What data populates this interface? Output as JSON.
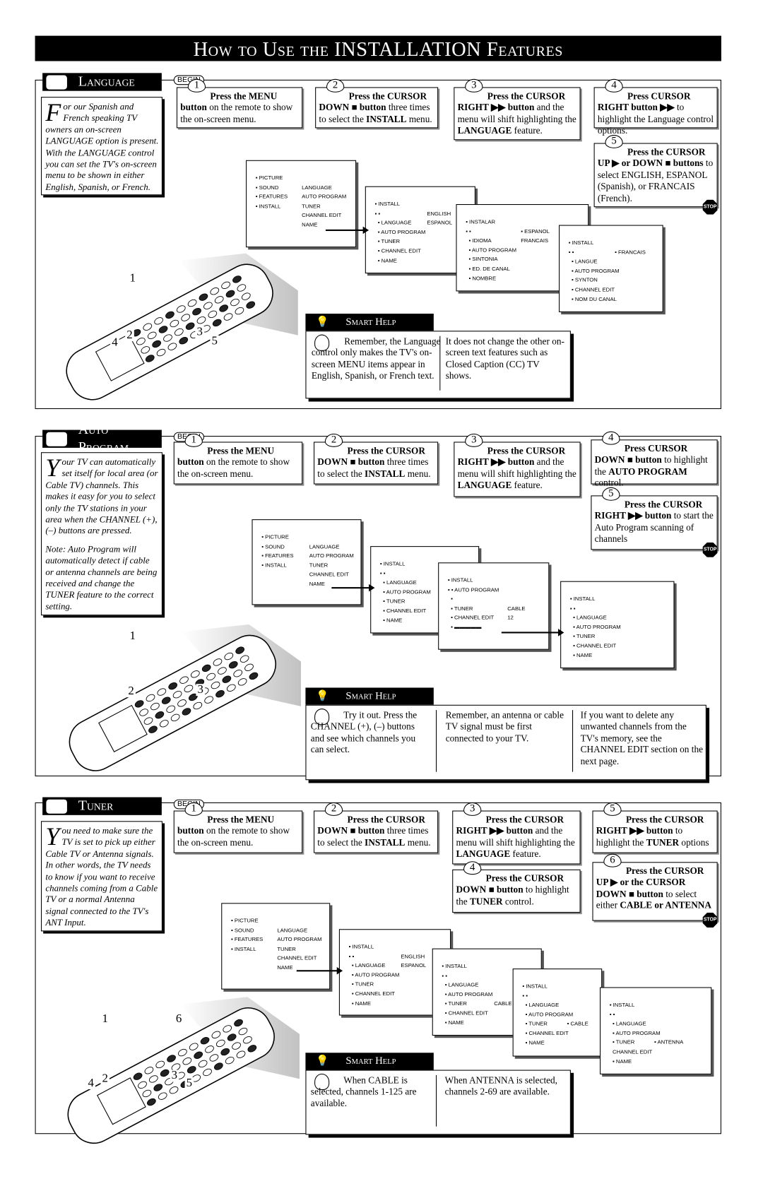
{
  "header": {
    "title": "How to Use the INSTALLATION Features"
  },
  "begin_label": "BEGIN",
  "stop_label": "STOP",
  "sections": [
    {
      "title": "Language",
      "intro": {
        "drop": "F",
        "paragraphs": [
          "or our Spanish and French speaking TV owners an on-screen LANGUAGE option is present. With the LANGUAGE control you can set the TV's on-screen menu to be shown in either English, Spanish, or French."
        ]
      },
      "steps": [
        {
          "n": "1",
          "segs": [
            {
              "t": "Press the MENU button",
              "b": true
            },
            {
              "t": " on the remote to show the on-screen menu."
            }
          ]
        },
        {
          "n": "2",
          "segs": [
            {
              "t": "Press the CURSOR DOWN ■ button",
              "b": true
            },
            {
              "t": " three times to select the "
            },
            {
              "t": "INSTALL",
              "b": true
            },
            {
              "t": " menu."
            }
          ]
        },
        {
          "n": "3",
          "segs": [
            {
              "t": "Press the CURSOR RIGHT ▶▶ button",
              "b": true
            },
            {
              "t": " and the menu will shift highlighting the "
            },
            {
              "t": "LANGUAGE",
              "b": true
            },
            {
              "t": " feature."
            }
          ]
        },
        {
          "n": "4",
          "segs": [
            {
              "t": "Press CURSOR RIGHT button ▶▶",
              "b": true
            },
            {
              "t": " to highlight the Language control options."
            }
          ]
        },
        {
          "n": "5",
          "segs": [
            {
              "t": "Press the CURSOR UP ▶ or DOWN ■ buttons",
              "b": true
            },
            {
              "t": " to select ENGLISH, ESPANOL (Spanish), or FRANCAIS (French)."
            }
          ]
        }
      ],
      "menus": [
        [
          [
            "▪ PICTURE",
            ""
          ],
          [
            "▪ SOUND",
            "LANGUAGE"
          ],
          [
            "▪ FEATURES",
            "AUTO PROGRAM"
          ],
          [
            "▪ INSTALL",
            "TUNER"
          ],
          [
            "",
            "CHANNEL EDIT"
          ],
          [
            "",
            "NAME"
          ]
        ],
        [
          [
            "▪ INSTALL",
            ""
          ],
          [
            "▪ ▪",
            "ENGLISH"
          ],
          [
            "  ▪ LANGUAGE",
            "ESPANOL"
          ],
          [
            "  ▪ AUTO PROGRAM",
            ""
          ],
          [
            "  ▪ TUNER",
            ""
          ],
          [
            "  ▪ CHANNEL EDIT",
            ""
          ],
          [
            "  ▪ NAME",
            ""
          ]
        ],
        [
          [
            "▪ INSTALAR",
            ""
          ],
          [
            "▪ ▪",
            "▪ ESPANOL"
          ],
          [
            "  ▪ IDIOMA",
            "FRANCAIS"
          ],
          [
            "  ▪ AUTO PROGRAM",
            ""
          ],
          [
            "  ▪ SINTONIA",
            ""
          ],
          [
            "  ▪ ED. DE CANAL",
            ""
          ],
          [
            "  ▪ NOMBRE",
            ""
          ]
        ],
        [
          [
            "▪ INSTALL",
            ""
          ],
          [
            "▪ ▪",
            "▪ FRANCAIS"
          ],
          [
            "  ▪ LANGUE",
            ""
          ],
          [
            "  ▪ AUTO PROGRAM",
            ""
          ],
          [
            "  ▪ SYNTON",
            ""
          ],
          [
            "  ▪ CHANNEL EDIT",
            ""
          ],
          [
            "  ▪ NOM DU CANAL",
            ""
          ]
        ]
      ],
      "smart_help": {
        "title": "Smart Help",
        "columns": [
          "Remember, the Language control only makes the TV's on-screen MENU items appear in English, Spanish, or French text.",
          "It does not change the other on-screen text features such as Closed Caption (CC) TV shows."
        ]
      },
      "callouts": [
        "1",
        "2",
        "4",
        "3",
        "5"
      ]
    },
    {
      "title": "Auto Program",
      "intro": {
        "drop": "Y",
        "paragraphs": [
          "our TV can automatically set itself for local area (or Cable TV) channels. This makes it easy for you to select only the TV stations in your area when the CHANNEL (+), (–) buttons are pressed.",
          "Note: Auto Program will automatically detect if cable or antenna channels are being received and change the TUNER feature to the correct setting."
        ]
      },
      "steps": [
        {
          "n": "1",
          "segs": [
            {
              "t": "Press the MENU button",
              "b": true
            },
            {
              "t": " on the remote to show the on-screen menu."
            }
          ]
        },
        {
          "n": "2",
          "segs": [
            {
              "t": "Press the CURSOR DOWN ■ button",
              "b": true
            },
            {
              "t": " three times to select the "
            },
            {
              "t": "INSTALL",
              "b": true
            },
            {
              "t": " menu."
            }
          ]
        },
        {
          "n": "3",
          "segs": [
            {
              "t": "Press the CURSOR RIGHT ▶▶ button",
              "b": true
            },
            {
              "t": " and the menu will shift highlighting the "
            },
            {
              "t": "LANGUAGE",
              "b": true
            },
            {
              "t": " feature."
            }
          ]
        },
        {
          "n": "4",
          "segs": [
            {
              "t": "Press CURSOR DOWN ■ button",
              "b": true
            },
            {
              "t": " to highlight the "
            },
            {
              "t": "AUTO PROGRAM",
              "b": true
            },
            {
              "t": " control."
            }
          ]
        },
        {
          "n": "5",
          "segs": [
            {
              "t": "Press the CURSOR RIGHT ▶▶ button",
              "b": true
            },
            {
              "t": " to start the Auto Program scanning of channels"
            }
          ]
        }
      ],
      "menus": [
        [
          [
            "▪ PICTURE",
            ""
          ],
          [
            "▪ SOUND",
            "LANGUAGE"
          ],
          [
            "▪ FEATURES",
            "AUTO PROGRAM"
          ],
          [
            "▪ INSTALL",
            "TUNER"
          ],
          [
            "",
            "CHANNEL EDIT"
          ],
          [
            "",
            "NAME"
          ]
        ],
        [
          [
            "▪ INSTALL",
            ""
          ],
          [
            "▪ ▪",
            ""
          ],
          [
            "  ▪ LANGUAGE",
            ""
          ],
          [
            "  ▪ AUTO PROGRAM",
            ""
          ],
          [
            "  ▪ TUNER",
            ""
          ],
          [
            "  ▪ CHANNEL EDIT",
            ""
          ],
          [
            "  ▪ NAME",
            ""
          ]
        ],
        [
          [
            "▪ INSTALL",
            ""
          ],
          [
            "▪ ▪ AUTO PROGRAM",
            ""
          ],
          [
            "  ▪",
            ""
          ],
          [
            "  ▪ TUNER",
            "CABLE"
          ],
          [
            "  ▪ CHANNEL EDIT",
            "12"
          ],
          [
            "  ▪ ▬▬▬▬▬",
            ""
          ]
        ],
        [
          [
            "▪ INSTALL",
            ""
          ],
          [
            "▪ ▪",
            ""
          ],
          [
            "  ▪ LANGUAGE",
            ""
          ],
          [
            "  ▪ AUTO PROGRAM",
            ""
          ],
          [
            "  ▪ TUNER",
            ""
          ],
          [
            "  ▪ CHANNEL EDIT",
            ""
          ],
          [
            "  ▪ NAME",
            ""
          ]
        ]
      ],
      "smart_help": {
        "title": "Smart Help",
        "columns": [
          "Try it out. Press the CHANNEL (+), (–) buttons and see which channels you can select.",
          "Remember, an antenna or cable TV signal must be first connected to your TV.",
          "If you want to delete any unwanted channels from the TV's memory, see the CHANNEL EDIT section on the next page."
        ]
      },
      "callouts": [
        "1",
        "2",
        "3"
      ]
    },
    {
      "title": "Tuner",
      "intro": {
        "drop": "Y",
        "paragraphs": [
          "ou need to make sure the TV is set to pick up either Cable TV or Antenna signals. In other words, the TV needs to know if you want to receive channels coming from a Cable TV or a normal Antenna signal connected to the TV's ANT Input."
        ]
      },
      "steps": [
        {
          "n": "1",
          "segs": [
            {
              "t": "Press the MENU button",
              "b": true
            },
            {
              "t": " on the remote to show the on-screen menu."
            }
          ]
        },
        {
          "n": "2",
          "segs": [
            {
              "t": "Press the CURSOR DOWN ■ button",
              "b": true
            },
            {
              "t": " three times to select the "
            },
            {
              "t": "INSTALL",
              "b": true
            },
            {
              "t": " menu."
            }
          ]
        },
        {
          "n": "3",
          "segs": [
            {
              "t": "Press the CURSOR RIGHT ▶▶ button",
              "b": true
            },
            {
              "t": " and the menu will shift highlighting the "
            },
            {
              "t": "LANGUAGE",
              "b": true
            },
            {
              "t": " feature."
            }
          ]
        },
        {
          "n": "4",
          "segs": [
            {
              "t": "Press the CURSOR DOWN ■ button",
              "b": true
            },
            {
              "t": " to highlight the "
            },
            {
              "t": "TUNER",
              "b": true
            },
            {
              "t": " control."
            }
          ]
        },
        {
          "n": "5",
          "segs": [
            {
              "t": "Press the CURSOR RIGHT ▶▶ button",
              "b": true
            },
            {
              "t": " to highlight the "
            },
            {
              "t": "TUNER",
              "b": true
            },
            {
              "t": " options"
            }
          ]
        },
        {
          "n": "6",
          "segs": [
            {
              "t": "Press the CURSOR UP ▶ or the CURSOR DOWN ■ button",
              "b": true
            },
            {
              "t": " to select either "
            },
            {
              "t": "CABLE or ANTENNA",
              "b": true
            }
          ]
        }
      ],
      "menus": [
        [
          [
            "▪ PICTURE",
            ""
          ],
          [
            "▪ SOUND",
            "LANGUAGE"
          ],
          [
            "▪ FEATURES",
            "AUTO PROGRAM"
          ],
          [
            "▪ INSTALL",
            "TUNER"
          ],
          [
            "",
            "CHANNEL EDIT"
          ],
          [
            "",
            "NAME"
          ]
        ],
        [
          [
            "▪ INSTALL",
            ""
          ],
          [
            "▪ ▪",
            "ENGLISH"
          ],
          [
            "  ▪ LANGUAGE",
            "ESPANOL"
          ],
          [
            "  ▪ AUTO PROGRAM",
            ""
          ],
          [
            "  ▪ TUNER",
            ""
          ],
          [
            "  ▪ CHANNEL EDIT",
            ""
          ],
          [
            "  ▪ NAME",
            ""
          ]
        ],
        [
          [
            "▪ INSTALL",
            ""
          ],
          [
            "▪ ▪",
            ""
          ],
          [
            "  ▪ LANGUAGE",
            ""
          ],
          [
            "  ▪ AUTO PROGRAM",
            ""
          ],
          [
            "  ▪ TUNER",
            "CABLE"
          ],
          [
            "  ▪ CHANNEL EDIT",
            ""
          ],
          [
            "  ▪ NAME",
            ""
          ]
        ],
        [
          [
            "▪ INSTALL",
            ""
          ],
          [
            "▪ ▪",
            ""
          ],
          [
            "  ▪ LANGUAGE",
            ""
          ],
          [
            "  ▪ AUTO PROGRAM",
            ""
          ],
          [
            "  ▪ TUNER",
            "▪ CABLE"
          ],
          [
            "  ▪ CHANNEL EDIT",
            ""
          ],
          [
            "  ▪ NAME",
            ""
          ]
        ],
        [
          [
            "▪ INSTALL",
            ""
          ],
          [
            "▪ ▪",
            ""
          ],
          [
            "  ▪ LANGUAGE",
            ""
          ],
          [
            "  ▪ AUTO PROGRAM",
            ""
          ],
          [
            "  ▪ TUNER",
            "▪ ANTENNA"
          ],
          [
            "  CHANNEL EDIT",
            ""
          ],
          [
            "  ▪ NAME",
            ""
          ]
        ]
      ],
      "smart_help": {
        "title": "Smart Help",
        "columns": [
          "When CABLE is selected, channels 1-125 are available.",
          "When ANTENNA is selected, channels 2-69 are available."
        ]
      },
      "callouts": [
        "1",
        "6",
        "4",
        "2",
        "3",
        "5"
      ]
    }
  ]
}
